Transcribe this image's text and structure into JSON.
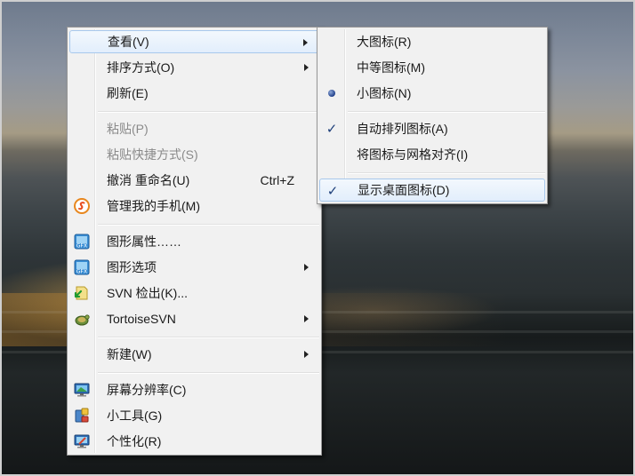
{
  "main_menu": {
    "items": [
      {
        "label": "查看(V)",
        "has_submenu": true
      },
      {
        "label": "排序方式(O)",
        "has_submenu": true
      },
      {
        "label": "刷新(E)"
      },
      {
        "label": "粘贴(P)",
        "disabled": true
      },
      {
        "label": "粘贴快捷方式(S)",
        "disabled": true
      },
      {
        "label": "撤消 重命名(U)",
        "accelerator": "Ctrl+Z"
      },
      {
        "label": "管理我的手机(M)",
        "icon": "phone-manager-icon"
      },
      {
        "label": "图形属性……",
        "icon": "graphics-icon"
      },
      {
        "label": "图形选项",
        "icon": "graphics-icon",
        "has_submenu": true
      },
      {
        "label": "SVN 检出(K)...",
        "icon": "svn-checkout-icon"
      },
      {
        "label": "TortoiseSVN",
        "icon": "tortoise-icon",
        "has_submenu": true
      },
      {
        "label": "新建(W)",
        "has_submenu": true
      },
      {
        "label": "屏幕分辨率(C)",
        "icon": "monitor-icon"
      },
      {
        "label": "小工具(G)",
        "icon": "gadgets-icon"
      },
      {
        "label": "个性化(R)",
        "icon": "personalize-icon"
      }
    ]
  },
  "view_submenu": {
    "items": [
      {
        "label": "大图标(R)"
      },
      {
        "label": "中等图标(M)"
      },
      {
        "label": "小图标(N)",
        "state": "radio-selected"
      },
      {
        "label": "自动排列图标(A)",
        "state": "checked"
      },
      {
        "label": "将图标与网格对齐(I)"
      },
      {
        "label": "显示桌面图标(D)",
        "state": "checked"
      }
    ]
  },
  "colors": {
    "menu_background": "#f1f1f1",
    "highlight": "#e2eefc",
    "disabled_text": "#8a8a8a"
  }
}
